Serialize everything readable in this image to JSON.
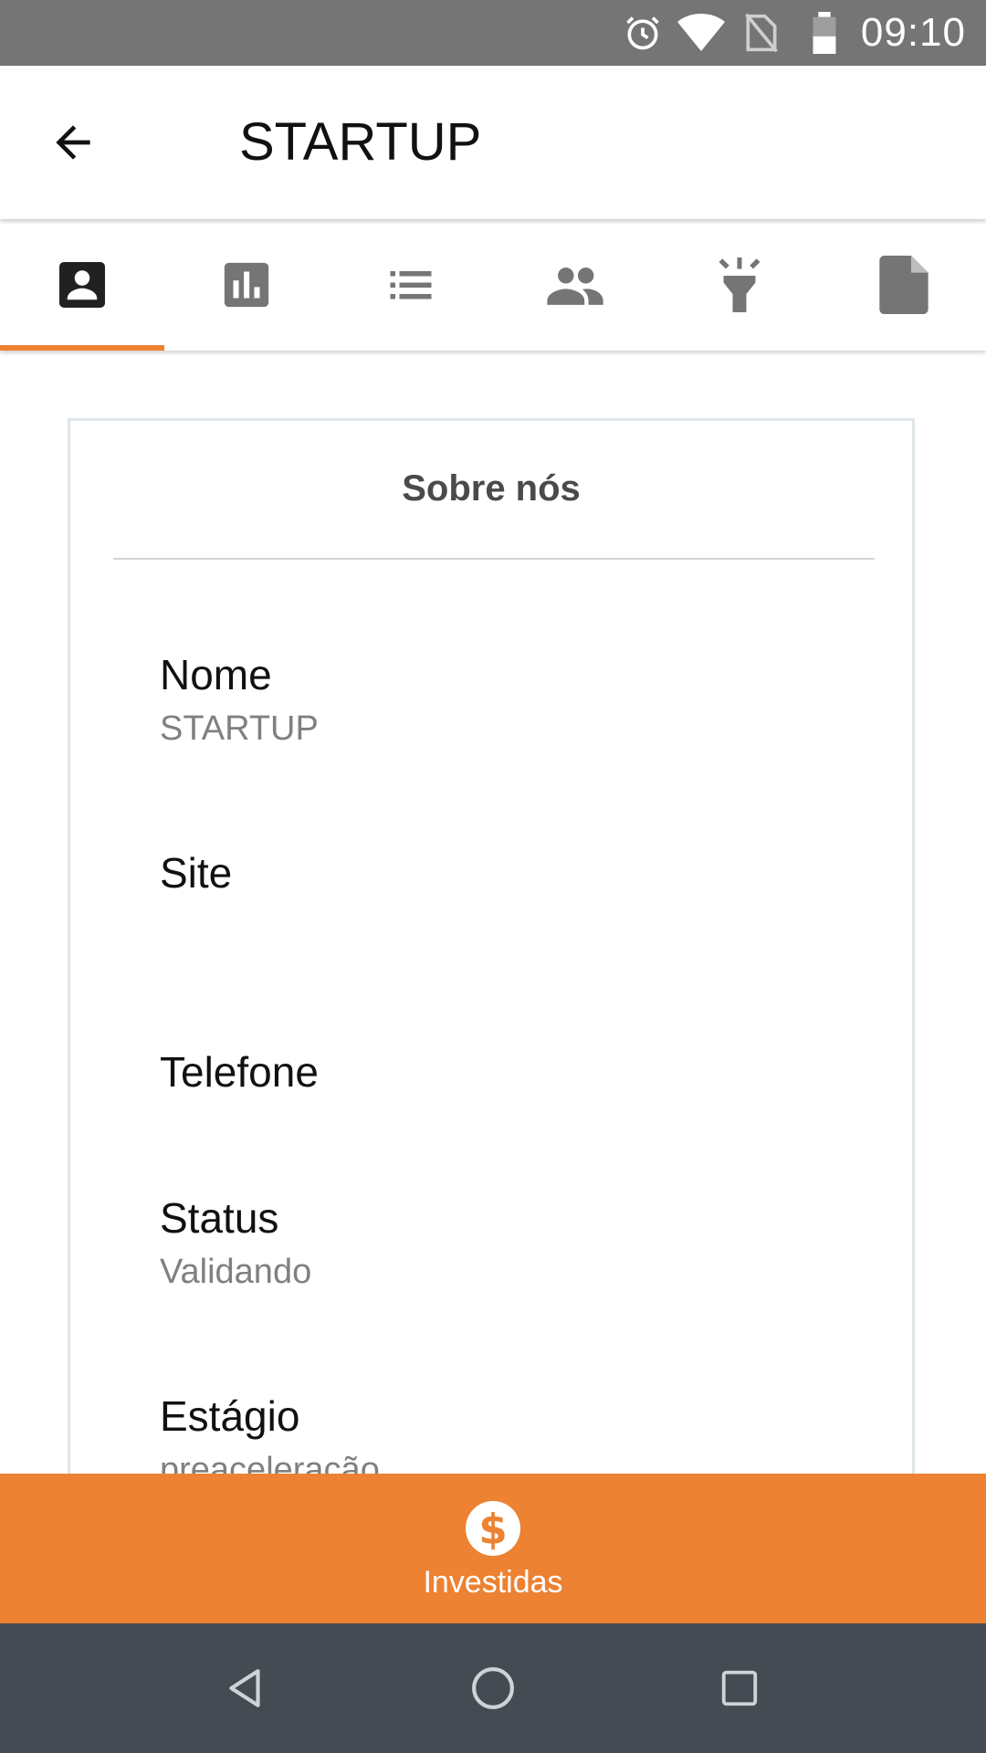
{
  "status_bar": {
    "time": "09:10",
    "icons": [
      "alarm-icon",
      "wifi-icon",
      "no-sim-icon",
      "battery-icon"
    ]
  },
  "app_bar": {
    "title": "STARTUP",
    "back_icon": "arrow-back-icon"
  },
  "tabs": [
    {
      "id": "profile",
      "icon": "account-box-icon",
      "selected": true
    },
    {
      "id": "stats",
      "icon": "bar-chart-icon",
      "selected": false
    },
    {
      "id": "list",
      "icon": "list-icon",
      "selected": false
    },
    {
      "id": "team",
      "icon": "people-icon",
      "selected": false
    },
    {
      "id": "ideas",
      "icon": "flashlight-icon",
      "selected": false
    },
    {
      "id": "documents",
      "icon": "document-icon",
      "selected": false
    }
  ],
  "card": {
    "title": "Sobre nós",
    "fields": [
      {
        "label": "Nome",
        "value": "STARTUP"
      },
      {
        "label": "Site",
        "value": ""
      },
      {
        "label": "Telefone",
        "value": ""
      },
      {
        "label": "Status",
        "value": "Validando"
      },
      {
        "label": "Estágio",
        "value": "preaceleração"
      }
    ]
  },
  "bottom_bar": {
    "label": "Investidas",
    "icon": "dollar-circle-icon"
  },
  "colors": {
    "accent": "#ec8232",
    "status_bar": "#757575",
    "nav_bar": "#454b53",
    "tab_icon": "#757575",
    "tab_icon_selected": "#212121"
  }
}
